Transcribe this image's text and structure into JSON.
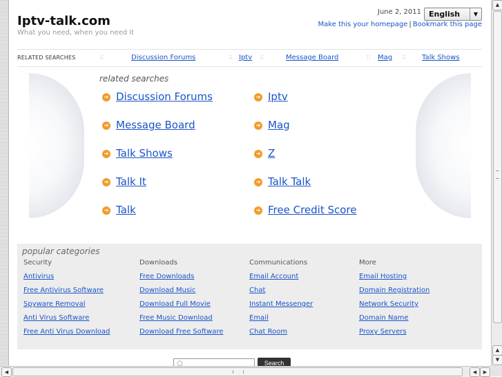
{
  "header": {
    "logo": "Iptv-talk.com",
    "tagline": "What you need, when you need it",
    "date": "June 2, 2011",
    "language": {
      "selected": "English"
    },
    "make_homepage": "Make this your homepage",
    "bookmark": "Bookmark this page"
  },
  "topbar": {
    "label": "RELATED SEARCHES",
    "separator": "::",
    "links": [
      "Discussion Forums",
      "Iptv",
      "Message Board",
      "Mag",
      "Talk Shows"
    ]
  },
  "related": {
    "title": "related searches",
    "items": [
      "Discussion Forums",
      "Iptv",
      "Message Board",
      "Mag",
      "Talk Shows",
      "Z",
      "Talk It",
      "Talk Talk",
      "Talk",
      "Free Credit Score"
    ]
  },
  "popular": {
    "title": "popular categories",
    "columns": [
      {
        "heading": "Security",
        "links": [
          "Antivirus",
          "Free Antivirus Software",
          "Spyware Removal",
          "Anti Virus Software",
          "Free Anti Virus Download"
        ]
      },
      {
        "heading": "Downloads",
        "links": [
          "Free Downloads",
          "Download Music",
          "Download Full Movie",
          "Free Music Download",
          "Download Free Software"
        ]
      },
      {
        "heading": "Communications",
        "links": [
          "Email Account",
          "Chat",
          "Instant Messenger",
          "Email",
          "Chat Room"
        ]
      },
      {
        "heading": "More",
        "links": [
          "Email Hosting",
          "Domain Registration",
          "Network Security",
          "Domain Name",
          "Proxy Servers"
        ]
      }
    ]
  },
  "search": {
    "value": "",
    "button": "Search"
  },
  "icons": {
    "bullet": "arrow-right-circle-icon",
    "search": "magnifier-icon"
  },
  "colors": {
    "link": "#1a54c8",
    "bullet": "#f29c2b",
    "panel": "#ededed"
  }
}
